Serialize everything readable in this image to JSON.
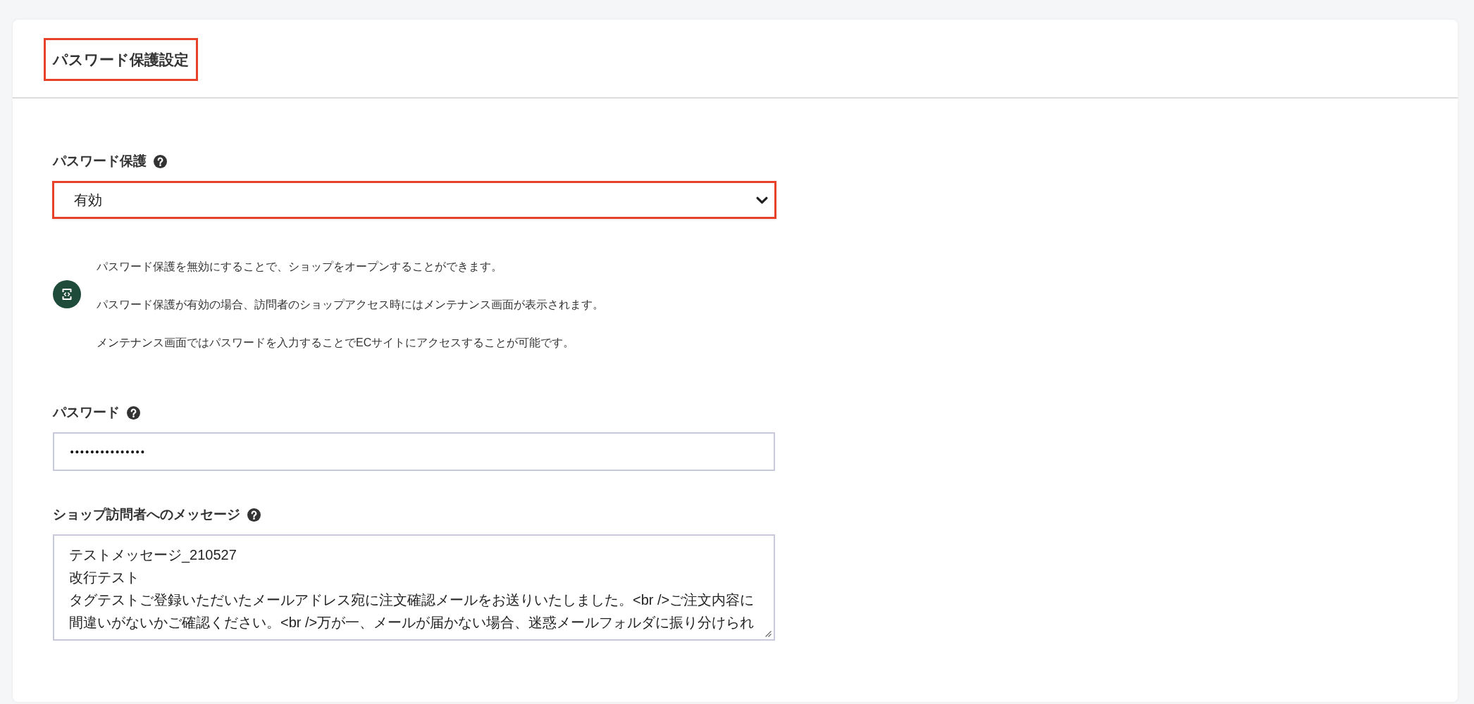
{
  "panel": {
    "title": "パスワード保護設定",
    "highlighted": true
  },
  "fields": [
    {
      "kind": "select",
      "label": "パスワード保護",
      "help": true,
      "value": "有効",
      "highlighted": true,
      "notes": [
        "パスワード保護を無効にすることで、ショップをオープンすることができます。",
        "パスワード保護が有効の場合、訪問者のショップアクセス時にはメンテナンス画面が表示されます。",
        "メンテナンス画面ではパスワードを入力することでECサイトにアクセスすることが可能です。"
      ]
    },
    {
      "kind": "password",
      "label": "パスワード",
      "help": true,
      "value": "•••••••••••••••",
      "highlighted": false
    },
    {
      "kind": "textarea",
      "label": "ショップ訪問者へのメッセージ",
      "help": true,
      "lines": [
        "テストメッセージ_210527",
        "改行テスト",
        "タグテストご登録いただいたメールアドレス宛に注文確認メールをお送りいたしました。<br />ご注文内容に",
        "間違いがないかご確認ください。<br />万が一、メールが届かない場合、迷惑メールフォルダに振り分けられ"
      ],
      "highlighted": false
    }
  ]
}
